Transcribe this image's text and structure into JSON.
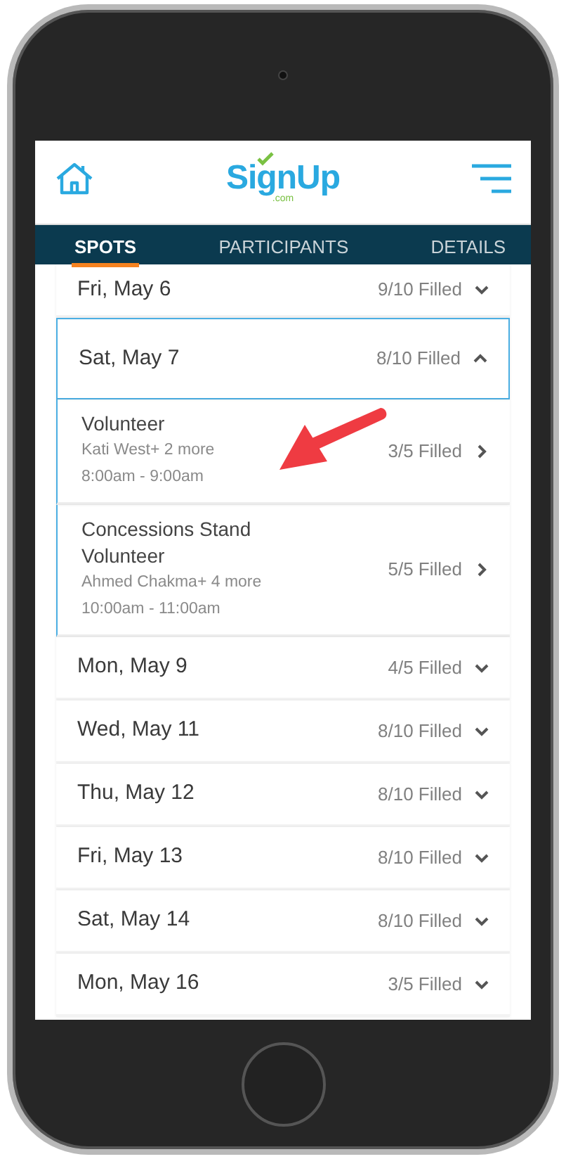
{
  "header": {
    "logo": {
      "text": "SignUp",
      "subtext": ".com"
    }
  },
  "tabs": [
    {
      "label": "SPOTS",
      "selected": true
    },
    {
      "label": "PARTICIPANTS",
      "selected": false
    },
    {
      "label": "DETAILS",
      "selected": false
    }
  ],
  "days": [
    {
      "date": "Fri, May 6",
      "filled": "9/10 Filled",
      "expanded": false
    },
    {
      "date": "Sat, May 7",
      "filled": "8/10 Filled",
      "expanded": true,
      "slots": [
        {
          "title": "Volunteer",
          "participants": "Kati West+ 2 more",
          "time": "8:00am - 9:00am",
          "filled": "3/5 Filled"
        },
        {
          "title": "Concessions Stand Volunteer",
          "participants": "Ahmed Chakma+ 4 more",
          "time": "10:00am - 11:00am",
          "filled": "5/5 Filled"
        }
      ]
    },
    {
      "date": "Mon, May 9",
      "filled": "4/5 Filled",
      "expanded": false
    },
    {
      "date": "Wed, May 11",
      "filled": "8/10 Filled",
      "expanded": false
    },
    {
      "date": "Thu, May 12",
      "filled": "8/10 Filled",
      "expanded": false
    },
    {
      "date": "Fri, May 13",
      "filled": "8/10 Filled",
      "expanded": false
    },
    {
      "date": "Sat, May 14",
      "filled": "8/10 Filled",
      "expanded": false
    },
    {
      "date": "Mon, May 16",
      "filled": "3/5 Filled",
      "expanded": false
    }
  ]
}
